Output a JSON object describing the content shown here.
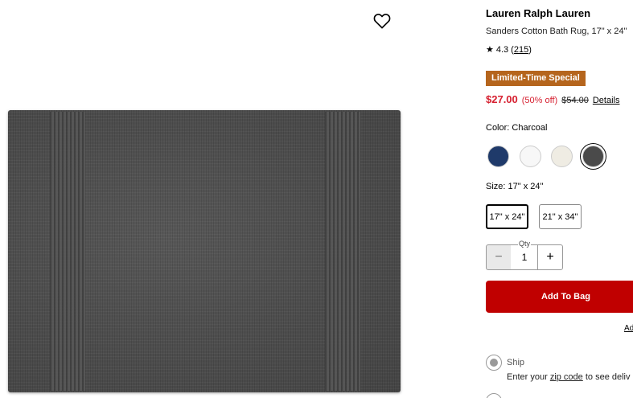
{
  "product": {
    "brand": "Lauren Ralph Lauren",
    "name": "Sanders Cotton Bath Rug, 17\" x 24\"",
    "rating": "4.3",
    "review_count": "215",
    "star_icon": "star-icon",
    "wishlist_icon": "heart-icon",
    "image_alt": "Charcoal cotton bath rug"
  },
  "promo": {
    "badge": "Limited-Time Special",
    "badge_color": "#b5651d"
  },
  "price": {
    "sale": "$27.00",
    "discount": "(50% off)",
    "original": "$54.00",
    "details_label": "Details",
    "sale_color": "#d62030"
  },
  "color": {
    "label": "Color: Charcoal",
    "swatches": [
      {
        "name": "Navy",
        "hex": "#1f3a6a"
      },
      {
        "name": "White",
        "hex": "#f7f7f7"
      },
      {
        "name": "Ivory",
        "hex": "#efece3"
      },
      {
        "name": "Charcoal",
        "hex": "#4a4a4a",
        "selected": true
      }
    ]
  },
  "size": {
    "label": "Size: 17\" x 24\"",
    "options": [
      {
        "label": "17\" x 24\"",
        "selected": true
      },
      {
        "label": "21\" x 34\"",
        "selected": false
      }
    ]
  },
  "quantity": {
    "label": "Qty",
    "value": "1",
    "minus": "−",
    "plus": "+"
  },
  "cta": {
    "add_to_bag": "Add To Bag",
    "secondary_link": "Ad",
    "color": "#c00000"
  },
  "shipping": {
    "option_label": "Ship",
    "info_prefix": "Enter your ",
    "zip_link": "zip code",
    "info_suffix": " to see deliv"
  }
}
